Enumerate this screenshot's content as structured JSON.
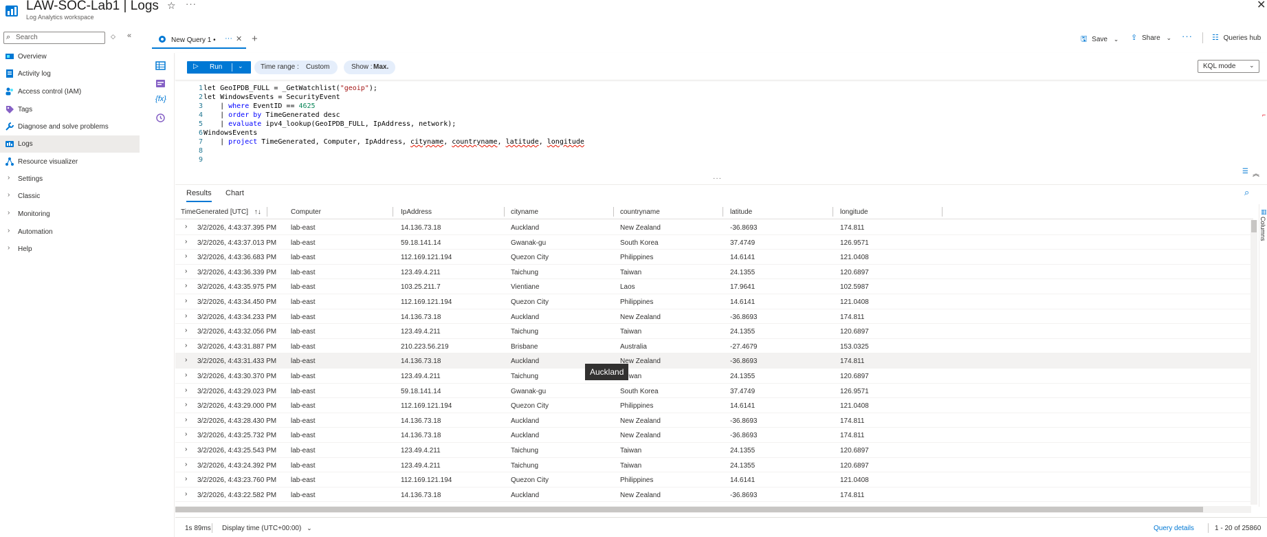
{
  "header": {
    "title": "LAW-SOC-Lab1 | Logs",
    "subtitle": "Log Analytics workspace",
    "star_icon": "star-icon",
    "more_icon": "more-icon",
    "close_icon": "close-icon"
  },
  "sidebar": {
    "search_placeholder": "Search",
    "items": [
      {
        "label": "Overview",
        "icon": "overview-icon",
        "type": "icon"
      },
      {
        "label": "Activity log",
        "icon": "activity-log-icon",
        "type": "icon"
      },
      {
        "label": "Access control (IAM)",
        "icon": "people-icon",
        "type": "icon"
      },
      {
        "label": "Tags",
        "icon": "tag-icon",
        "type": "icon"
      },
      {
        "label": "Diagnose and solve problems",
        "icon": "wrench-icon",
        "type": "icon"
      },
      {
        "label": "Logs",
        "icon": "logs-icon",
        "type": "icon",
        "active": true
      },
      {
        "label": "Resource visualizer",
        "icon": "resource-visualizer-icon",
        "type": "icon"
      },
      {
        "label": "Settings",
        "type": "group"
      },
      {
        "label": "Classic",
        "type": "group"
      },
      {
        "label": "Monitoring",
        "type": "group"
      },
      {
        "label": "Automation",
        "type": "group"
      },
      {
        "label": "Help",
        "type": "group"
      }
    ]
  },
  "tabs": {
    "query_tab_label": "New Query 1 •",
    "more": "···",
    "close": "✕",
    "add": "+"
  },
  "actions": {
    "save": "Save",
    "share": "Share",
    "more": "···",
    "queries_hub": "Queries hub"
  },
  "toolbar": {
    "run_label": "Run",
    "time_range_label": "Time range : ",
    "time_range_value": "Custom",
    "show_label": "Show : ",
    "show_value": "Max.",
    "mode": "KQL mode"
  },
  "editor": {
    "line_numbers": [
      "1",
      "2",
      "3",
      "4",
      "5",
      "6",
      "7",
      "8",
      "9"
    ],
    "lines": [
      "let GeoIPDB_FULL = _GetWatchlist(\"geoip\");",
      "let WindowsEvents = SecurityEvent",
      "    | where EventID == 4625",
      "    | order by TimeGenerated desc",
      "    | evaluate ipv4_lookup(GeoIPDB_FULL, IpAddress, network);",
      "WindowsEvents",
      "    | project TimeGenerated, Computer, IpAddress, cityname, countryname, latitude, longitude",
      "",
      ""
    ]
  },
  "results": {
    "tabs": [
      "Results",
      "Chart"
    ],
    "columns": [
      "TimeGenerated [UTC]",
      "Computer",
      "IpAddress",
      "cityname",
      "countryname",
      "latitude",
      "longitude"
    ],
    "sort_indicator": "↑↓",
    "rows": [
      [
        "3/2/2026, 4:43:37.395 PM",
        "lab-east",
        "14.136.73.18",
        "Auckland",
        "New Zealand",
        "-36.8693",
        "174.811"
      ],
      [
        "3/2/2026, 4:43:37.013 PM",
        "lab-east",
        "59.18.141.14",
        "Gwanak-gu",
        "South Korea",
        "37.4749",
        "126.9571"
      ],
      [
        "3/2/2026, 4:43:36.683 PM",
        "lab-east",
        "112.169.121.194",
        "Quezon City",
        "Philippines",
        "14.6141",
        "121.0408"
      ],
      [
        "3/2/2026, 4:43:36.339 PM",
        "lab-east",
        "123.49.4.211",
        "Taichung",
        "Taiwan",
        "24.1355",
        "120.6897"
      ],
      [
        "3/2/2026, 4:43:35.975 PM",
        "lab-east",
        "103.25.211.7",
        "Vientiane",
        "Laos",
        "17.9641",
        "102.5987"
      ],
      [
        "3/2/2026, 4:43:34.450 PM",
        "lab-east",
        "112.169.121.194",
        "Quezon City",
        "Philippines",
        "14.6141",
        "121.0408"
      ],
      [
        "3/2/2026, 4:43:34.233 PM",
        "lab-east",
        "14.136.73.18",
        "Auckland",
        "New Zealand",
        "-36.8693",
        "174.811"
      ],
      [
        "3/2/2026, 4:43:32.056 PM",
        "lab-east",
        "123.49.4.211",
        "Taichung",
        "Taiwan",
        "24.1355",
        "120.6897"
      ],
      [
        "3/2/2026, 4:43:31.887 PM",
        "lab-east",
        "210.223.56.219",
        "Brisbane",
        "Australia",
        "-27.4679",
        "153.0325"
      ],
      [
        "3/2/2026, 4:43:31.433 PM",
        "lab-east",
        "14.136.73.18",
        "Auckland",
        "New Zealand",
        "-36.8693",
        "174.811"
      ],
      [
        "3/2/2026, 4:43:30.370 PM",
        "lab-east",
        "123.49.4.211",
        "Taichung",
        "Taiwan",
        "24.1355",
        "120.6897"
      ],
      [
        "3/2/2026, 4:43:29.023 PM",
        "lab-east",
        "59.18.141.14",
        "Gwanak-gu",
        "South Korea",
        "37.4749",
        "126.9571"
      ],
      [
        "3/2/2026, 4:43:29.000 PM",
        "lab-east",
        "112.169.121.194",
        "Quezon City",
        "Philippines",
        "14.6141",
        "121.0408"
      ],
      [
        "3/2/2026, 4:43:28.430 PM",
        "lab-east",
        "14.136.73.18",
        "Auckland",
        "New Zealand",
        "-36.8693",
        "174.811"
      ],
      [
        "3/2/2026, 4:43:25.732 PM",
        "lab-east",
        "14.136.73.18",
        "Auckland",
        "New Zealand",
        "-36.8693",
        "174.811"
      ],
      [
        "3/2/2026, 4:43:25.543 PM",
        "lab-east",
        "123.49.4.211",
        "Taichung",
        "Taiwan",
        "24.1355",
        "120.6897"
      ],
      [
        "3/2/2026, 4:43:24.392 PM",
        "lab-east",
        "123.49.4.211",
        "Taichung",
        "Taiwan",
        "24.1355",
        "120.6897"
      ],
      [
        "3/2/2026, 4:43:23.760 PM",
        "lab-east",
        "112.169.121.194",
        "Quezon City",
        "Philippines",
        "14.6141",
        "121.0408"
      ],
      [
        "3/2/2026, 4:43:22.582 PM",
        "lab-east",
        "14.136.73.18",
        "Auckland",
        "New Zealand",
        "-36.8693",
        "174.811"
      ]
    ],
    "hovered_row": 9,
    "tooltip": "Auckland",
    "columns_panel_label": "Columns"
  },
  "footer": {
    "exec_time": "1s 89ms",
    "display_time": "Display time (UTC+00:00)",
    "query_details": "Query details",
    "page_count": "1 - 20 of 25860"
  },
  "colors": {
    "accent": "#0078d4",
    "pill_bg": "#e5eefb",
    "keyword": "#0000ff",
    "string": "#a31515",
    "number": "#098658"
  }
}
